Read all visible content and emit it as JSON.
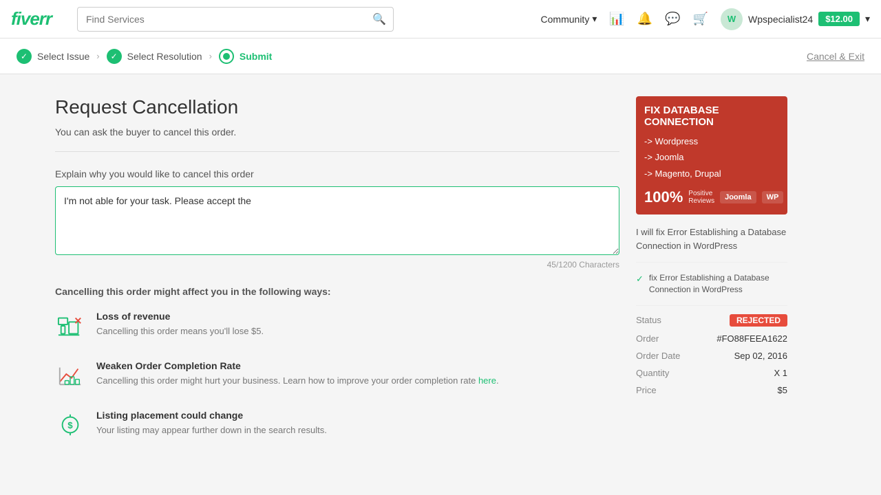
{
  "header": {
    "logo": "fiverr",
    "search_placeholder": "Find Services",
    "search_value": "",
    "community_label": "Community",
    "community_arrow": "▾",
    "username": "Wpspecialist24",
    "balance": "$12.00",
    "balance_arrow": "▾"
  },
  "breadcrumb": {
    "step1_label": "Select Issue",
    "step2_label": "Select Resolution",
    "step3_label": "Submit",
    "cancel_label": "Cancel & Exit"
  },
  "main": {
    "page_title": "Request Cancellation",
    "page_subtitle": "You can ask the buyer to cancel this order.",
    "section_label": "Explain why you would like to cancel this order",
    "textarea_value": "I'm not able for your task. Please accept the",
    "char_count": "45/1200 Characters",
    "effects_title": "Cancelling this order might affect you in the following ways:",
    "effect1": {
      "title": "Loss of revenue",
      "desc": "Cancelling this order means you'll lose $5."
    },
    "effect2": {
      "title": "Weaken Order Completion Rate",
      "desc": "Cancelling this order might hurt your business.\nLearn how to improve your order completion rate ",
      "link_text": "here",
      "desc_after": "."
    },
    "effect3": {
      "title": "Listing placement could change",
      "desc": "Your listing may appear further down in the search results."
    }
  },
  "sidebar": {
    "ad_title": "FIX DATABASE CONNECTION",
    "ad_item1": "-> Wordpress",
    "ad_item2": "-> Joomla",
    "ad_item3": "-> Magento, Drupal",
    "ad_percent": "100%",
    "ad_reviews": "Positive Reviews",
    "service_desc": "I will fix Error Establishing a Database Connection in WordPress",
    "service_check": "fix Error Establishing a Database Connection in WordPress",
    "status_label": "Status",
    "status_value": "REJECTED",
    "order_label": "Order",
    "order_value": "#FO88FEEA1622",
    "order_date_label": "Order Date",
    "order_date_value": "Sep 02, 2016",
    "quantity_label": "Quantity",
    "quantity_value": "X 1",
    "price_label": "Price",
    "price_value": "$5"
  }
}
